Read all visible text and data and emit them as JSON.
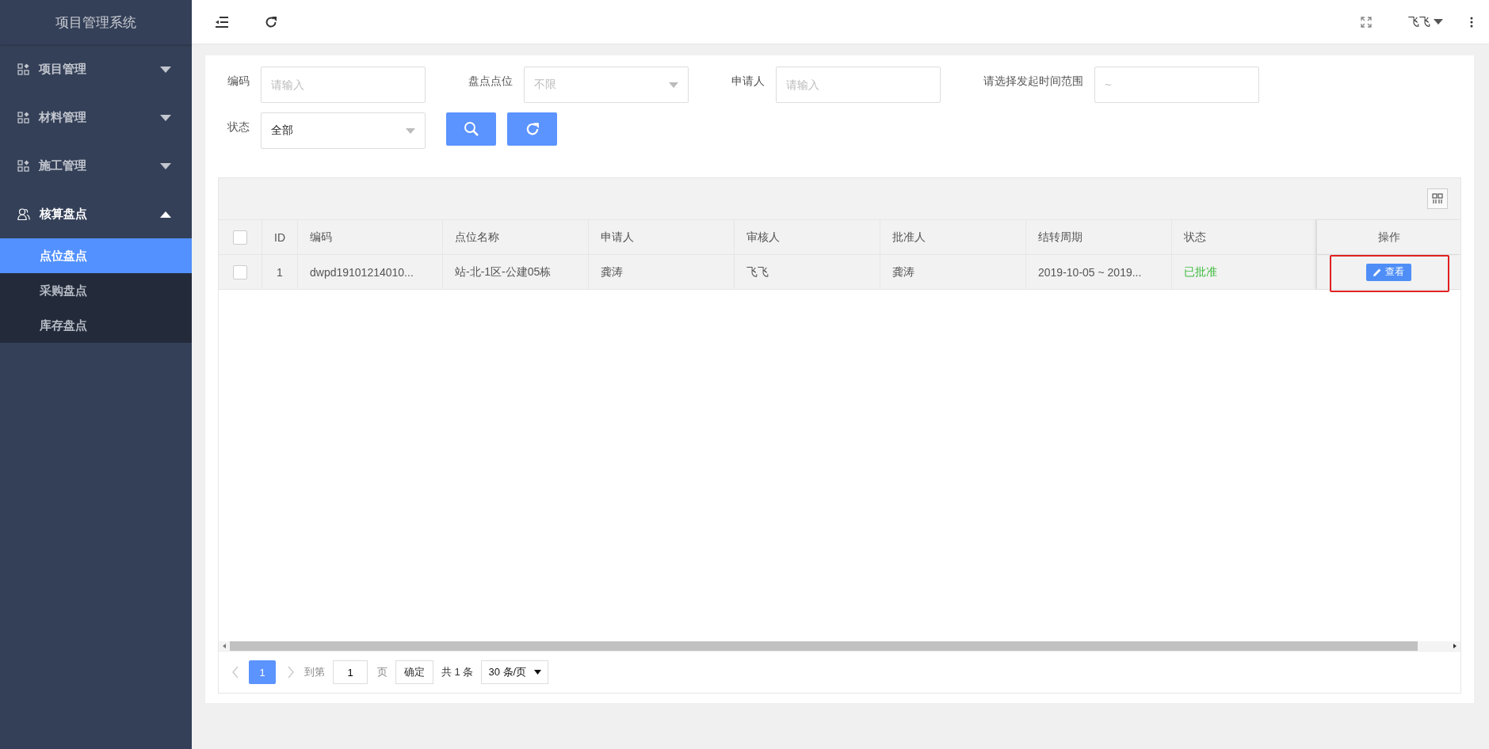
{
  "sidebar": {
    "title": "项目管理系统",
    "menu": [
      {
        "label": "项目管理",
        "kind": "module",
        "expanded": false
      },
      {
        "label": "材料管理",
        "kind": "module",
        "expanded": false
      },
      {
        "label": "施工管理",
        "kind": "module",
        "expanded": false
      },
      {
        "label": "核算盘点",
        "kind": "account",
        "expanded": true,
        "children": [
          {
            "label": "点位盘点",
            "selected": true
          },
          {
            "label": "采购盘点",
            "selected": false
          },
          {
            "label": "库存盘点",
            "selected": false
          }
        ]
      }
    ]
  },
  "header": {
    "user": "飞飞"
  },
  "filters": [
    {
      "label": "编码",
      "kind": "text",
      "placeholder": "请输入"
    },
    {
      "label": "盘点点位",
      "kind": "select",
      "placeholder": "不限"
    },
    {
      "label": "申请人",
      "kind": "text",
      "placeholder": "请输入"
    },
    {
      "label": "请选择发起时间范围",
      "kind": "range",
      "placeholder": "~"
    },
    {
      "label": "状态",
      "kind": "select",
      "value": "全部"
    }
  ],
  "table": {
    "all_checked": false,
    "columns": [
      {
        "label": "ID",
        "kind": "id"
      },
      {
        "label": "编码",
        "kind": "text"
      },
      {
        "label": "点位名称",
        "kind": "text"
      },
      {
        "label": "申请人",
        "kind": "text"
      },
      {
        "label": "审核人",
        "kind": "text"
      },
      {
        "label": "批准人",
        "kind": "text"
      },
      {
        "label": "结转周期",
        "kind": "text"
      },
      {
        "label": "状态",
        "kind": "status"
      },
      {
        "label": "操作",
        "kind": "action"
      }
    ],
    "rows": [
      {
        "checked": false,
        "cells": [
          "1",
          "dwpd19101214010...",
          "站-北-1区-公建05栋",
          "龚涛",
          "飞飞",
          "龚涛",
          "2019-10-05 ~ 2019...",
          "已批准",
          "查看"
        ],
        "highlighted": true
      }
    ]
  },
  "pagination": {
    "pages": [
      {
        "label": "1",
        "selected": true
      }
    ],
    "goto_label": "到第",
    "goto_value": "1",
    "page_unit": "页",
    "confirm": "确定",
    "total": "共 1 条",
    "page_size": "30 条/页"
  }
}
